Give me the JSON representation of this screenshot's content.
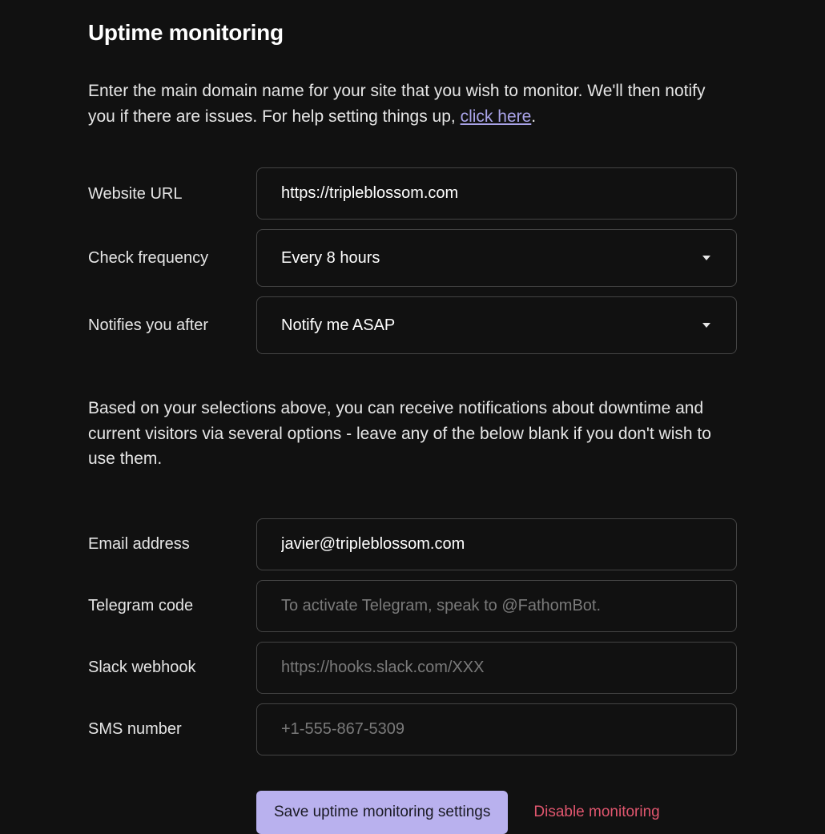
{
  "page": {
    "title": "Uptime monitoring",
    "intro_text_before_link": "Enter the main domain name for your site that you wish to monitor. We'll then notify you if there are issues. For help setting things up, ",
    "intro_link_text": "click here",
    "intro_text_after_link": ".",
    "description": "Based on your selections above, you can receive notifications about downtime and current visitors via several options - leave any of the below blank if you don't wish to use them."
  },
  "fields": {
    "website_url": {
      "label": "Website URL",
      "value": "https://tripleblossom.com"
    },
    "check_frequency": {
      "label": "Check frequency",
      "value": "Every 8 hours"
    },
    "notify_after": {
      "label": "Notifies you after",
      "value": "Notify me ASAP"
    },
    "email": {
      "label": "Email address",
      "value": "javier@tripleblossom.com"
    },
    "telegram": {
      "label": "Telegram code",
      "placeholder": "To activate Telegram, speak to @FathomBot.",
      "value": ""
    },
    "slack": {
      "label": "Slack webhook",
      "placeholder": "https://hooks.slack.com/XXX",
      "value": ""
    },
    "sms": {
      "label": "SMS number",
      "placeholder": "+1-555-867-5309",
      "value": ""
    }
  },
  "buttons": {
    "save": "Save uptime monitoring settings",
    "disable": "Disable monitoring"
  }
}
